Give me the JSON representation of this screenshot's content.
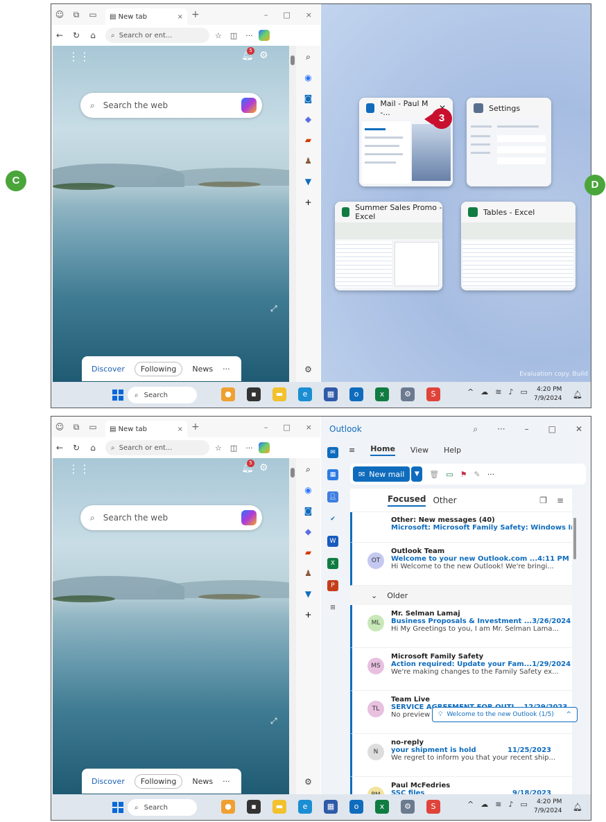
{
  "callouts": {
    "c": "C",
    "d": "D",
    "three": "3"
  },
  "browser": {
    "tab_title": "New tab",
    "tab_close": "×",
    "new_tab": "+",
    "window_buttons": [
      "–",
      "□",
      "×"
    ],
    "address_placeholder": "Search or ent...",
    "search_placeholder": "Search the web",
    "notification_count": "5",
    "feed_tabs": [
      "Discover",
      "Following",
      "News",
      "···"
    ]
  },
  "taskbar": {
    "search_label": "Search",
    "time": "4:20 PM",
    "date": "7/9/2024"
  },
  "snap_assist": {
    "windows": [
      {
        "title": "Mail - Paul M -..."
      },
      {
        "title": "Settings"
      },
      {
        "title": "Summer Sales Promo - Excel"
      },
      {
        "title": "Tables - Excel"
      }
    ],
    "watermark": "Evaluation copy. Build"
  },
  "outlook": {
    "app_title": "Outlook",
    "menu": [
      "Home",
      "View",
      "Help"
    ],
    "new_mail": "New mail",
    "tabs": {
      "focused": "Focused",
      "other": "Other"
    },
    "other_summary": {
      "title": "Other: New messages (40)",
      "subtitle": "Microsoft: Microsoft Family Safety: Windows Insider ..."
    },
    "older_label": "Older",
    "messages": [
      {
        "initials": "OT",
        "from": "Outlook Team",
        "subject": "Welcome to your new Outlook.com ...",
        "date": "4:11 PM",
        "preview": "Hi Welcome to the new Outlook! We're bringi...",
        "color": "#c5c8f0"
      },
      {
        "initials": "ML",
        "from": "Mr. Selman Lamaj",
        "subject": "Business Proposals & Investment ...",
        "date": "3/26/2024",
        "preview": "Hi My Greetings to you, I am Mr. Selman Lama...",
        "color": "#c8e8b8"
      },
      {
        "initials": "MS",
        "from": "Microsoft Family Safety",
        "subject": "Action required: Update your Fam...",
        "date": "1/29/2024",
        "preview": "We're making changes to the Family Safety ex...",
        "color": "#e8c0e0"
      },
      {
        "initials": "TL",
        "from": "Team Live",
        "subject": "SERVICE AGREEMENT FOR OUTL...",
        "date": "12/29/2023",
        "preview": "No preview is available.",
        "color": "#e8c0e0"
      },
      {
        "initials": "N",
        "from": "no-reply",
        "subject": "your shipment is hold",
        "date": "11/25/2023",
        "preview": "We regret to inform you that your recent ship...",
        "color": "#dddddd"
      },
      {
        "initials": "PM",
        "from": "Paul McFedries",
        "subject": "SSC files",
        "date": "9/18/2023",
        "preview": "",
        "color": "#f3e3a0"
      }
    ],
    "toast": "Welcome to the new Outlook (1/5)"
  }
}
